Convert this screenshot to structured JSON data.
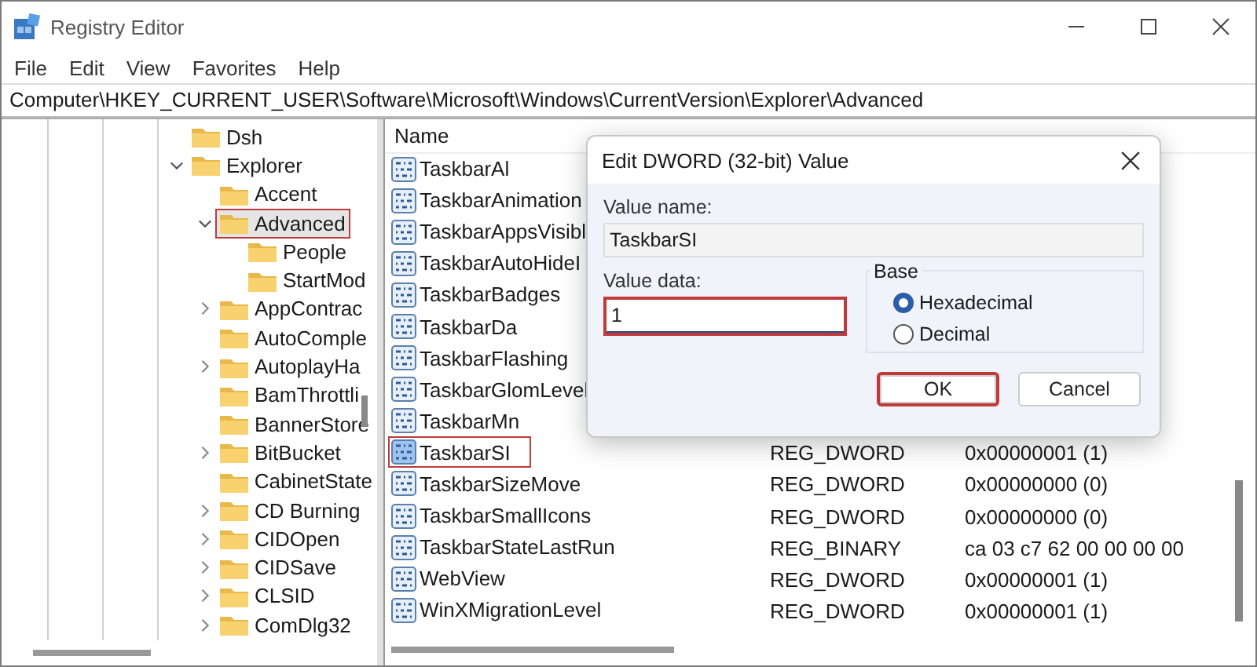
{
  "window": {
    "title": "Registry Editor"
  },
  "menu": [
    "File",
    "Edit",
    "View",
    "Favorites",
    "Help"
  ],
  "address": "Computer\\HKEY_CURRENT_USER\\Software\\Microsoft\\Windows\\CurrentVersion\\Explorer\\Advanced",
  "tree": [
    {
      "label": "Dsh",
      "highlighted": false
    },
    {
      "label": "Explorer",
      "expanded": true,
      "highlighted": false,
      "children": [
        {
          "label": "Accent",
          "highlighted": false
        },
        {
          "label": "Advanced",
          "expanded": true,
          "highlighted": true,
          "children": [
            {
              "label": "People",
              "highlighted": false
            },
            {
              "label": "StartMod",
              "highlighted": false
            }
          ]
        },
        {
          "label": "AppContrac",
          "expanded": false,
          "highlighted": false
        },
        {
          "label": "AutoComple",
          "highlighted": false
        },
        {
          "label": "AutoplayHa",
          "expanded": false,
          "highlighted": false
        },
        {
          "label": "BamThrottli",
          "highlighted": false
        },
        {
          "label": "BannerStore",
          "highlighted": false
        },
        {
          "label": "BitBucket",
          "expanded": false,
          "highlighted": false
        },
        {
          "label": "CabinetState",
          "highlighted": false
        },
        {
          "label": "CD Burning",
          "expanded": false,
          "highlighted": false
        },
        {
          "label": "CIDOpen",
          "expanded": false,
          "highlighted": false
        },
        {
          "label": "CIDSave",
          "expanded": false,
          "highlighted": false
        },
        {
          "label": "CLSID",
          "expanded": false,
          "highlighted": false
        },
        {
          "label": "ComDlg32",
          "expanded": false,
          "highlighted": false
        }
      ]
    }
  ],
  "list": {
    "columns": [
      {
        "label": "Name"
      }
    ],
    "rows": [
      {
        "name": "TaskbarAl",
        "highlighted": false
      },
      {
        "name": "TaskbarAnimation",
        "highlighted": false
      },
      {
        "name": "TaskbarAppsVisibl",
        "highlighted": false
      },
      {
        "name": "TaskbarAutoHideI",
        "highlighted": false
      },
      {
        "name": "TaskbarBadges",
        "highlighted": false
      },
      {
        "name": "TaskbarDa",
        "highlighted": false
      },
      {
        "name": "TaskbarFlashing",
        "highlighted": false
      },
      {
        "name": "TaskbarGlomLevel",
        "highlighted": false
      },
      {
        "name": "TaskbarMn",
        "highlighted": false
      },
      {
        "name": "TaskbarSI",
        "type": "REG_DWORD",
        "data": "0x00000001 (1)",
        "highlighted": true
      },
      {
        "name": "TaskbarSizeMove",
        "type": "REG_DWORD",
        "data": "0x00000000 (0)",
        "highlighted": false
      },
      {
        "name": "TaskbarSmallIcons",
        "type": "REG_DWORD",
        "data": "0x00000000 (0)",
        "highlighted": false
      },
      {
        "name": "TaskbarStateLastRun",
        "type": "REG_BINARY",
        "data": "ca 03 c7 62 00 00 00 00",
        "highlighted": false
      },
      {
        "name": "WebView",
        "type": "REG_DWORD",
        "data": "0x00000001 (1)",
        "highlighted": false
      },
      {
        "name": "WinXMigrationLevel",
        "type": "REG_DWORD",
        "data": "0x00000001 (1)",
        "highlighted": false
      }
    ]
  },
  "dialog": {
    "title": "Edit DWORD (32-bit) Value",
    "value_name_label": "Value name:",
    "value_name": "TaskbarSI",
    "value_data_label": "Value data:",
    "value_data": {
      "value": "1",
      "highlighted": true
    },
    "base": {
      "label": "Base",
      "options": [
        {
          "label": "Hexadecimal",
          "selected": true
        },
        {
          "label": "Decimal",
          "selected": false
        }
      ]
    },
    "buttons": [
      {
        "label": "OK",
        "highlighted": true
      },
      {
        "label": "Cancel",
        "highlighted": false
      }
    ]
  }
}
